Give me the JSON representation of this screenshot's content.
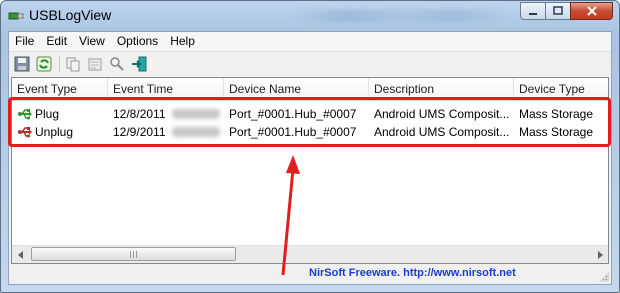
{
  "window": {
    "title": "USBLogView",
    "caption_buttons": [
      "minimize",
      "maximize",
      "close"
    ]
  },
  "menu": {
    "items": [
      {
        "label": "File"
      },
      {
        "label": "Edit"
      },
      {
        "label": "View"
      },
      {
        "label": "Options"
      },
      {
        "label": "Help"
      }
    ]
  },
  "toolbar": {
    "buttons": [
      {
        "icon": "save-icon"
      },
      {
        "icon": "refresh-icon"
      },
      {
        "icon": "copy-icon"
      },
      {
        "icon": "properties-icon"
      },
      {
        "icon": "find-icon"
      },
      {
        "icon": "exit-icon"
      }
    ]
  },
  "table": {
    "columns": [
      "Event Type",
      "Event Time",
      "Device Name",
      "Description",
      "Device Type"
    ],
    "rows": [
      {
        "event_type": "Plug",
        "event_time": "12/8/2011",
        "device_name": "Port_#0001.Hub_#0007",
        "description": "Android UMS Composit...",
        "device_type": "Mass Storage",
        "icon": "usb-plug-icon"
      },
      {
        "event_type": "Unplug",
        "event_time": "12/9/2011",
        "device_name": "Port_#0001.Hub_#0007",
        "description": "Android UMS Composit...",
        "device_type": "Mass Storage",
        "icon": "usb-unplug-icon"
      }
    ]
  },
  "statusbar": {
    "text": "NirSoft Freeware.  http://www.nirsoft.net"
  },
  "colors": {
    "annotation": "#e01e1e",
    "status_link": "#1a3ccf",
    "plug_green": "#2f9a2f",
    "unplug_red": "#b03030"
  }
}
